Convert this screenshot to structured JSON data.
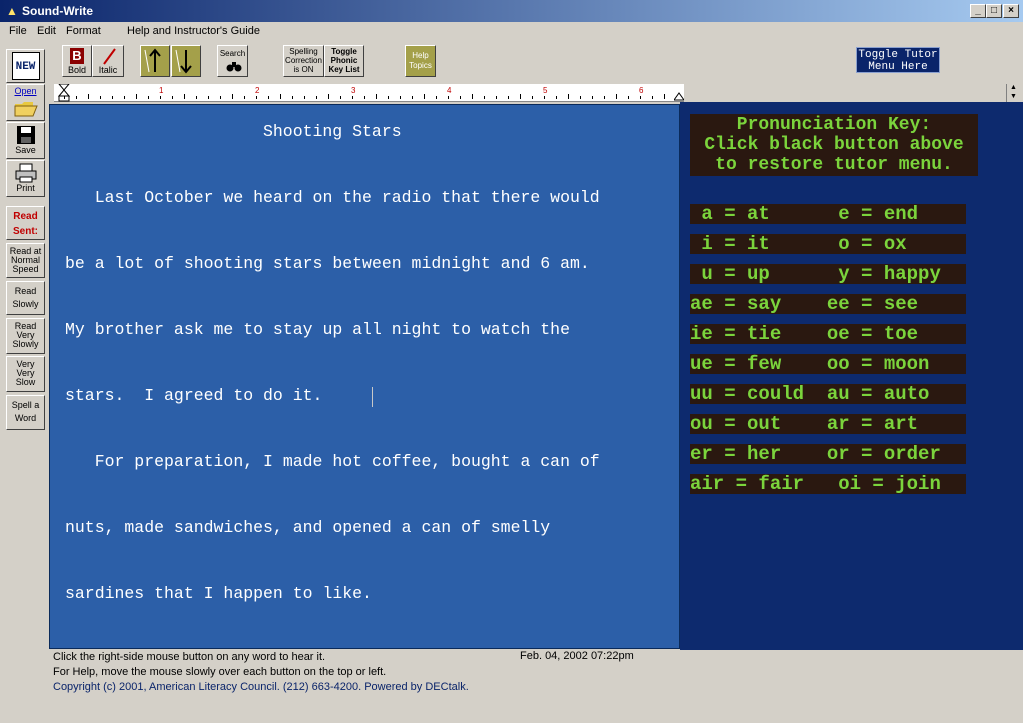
{
  "window": {
    "title": "Sound-Write"
  },
  "menu": [
    "File",
    "Edit",
    "Format",
    "Help and Instructor's Guide"
  ],
  "toolbar": {
    "bold": "Bold",
    "italic": "Italic",
    "search": "Search",
    "spelling": [
      "Spelling",
      "Correction",
      "is ON"
    ],
    "toggle_phonic": [
      "Toggle",
      "Phonic",
      "Key List"
    ],
    "help_topics": [
      "Help",
      "Topics"
    ],
    "tutor": [
      "Toggle Tutor",
      "Menu  Here"
    ]
  },
  "sidebar": {
    "new": "NEW",
    "open": "Open",
    "save": "Save",
    "print": "Print",
    "read_sent": [
      "Read",
      "Sent:"
    ],
    "normal": [
      "Read at",
      "Normal",
      "Speed"
    ],
    "slowly": [
      "Read",
      "Slowly"
    ],
    "very_slowly": [
      "Read",
      "Very",
      "Slowly"
    ],
    "very_very": [
      "Very",
      "Very",
      "Slow"
    ],
    "spell": [
      "Spell a",
      "Word"
    ]
  },
  "ruler_numbers": [
    "1",
    "2",
    "3",
    "4",
    "5",
    "6"
  ],
  "document": {
    "title": "Shooting Stars",
    "lines": [
      "   Last October we heard on the radio that there would",
      "be a lot of shooting stars between midnight and 6 am.",
      "My brother ask me to stay up all night to watch the",
      "stars.  I agreed to do it.",
      "   For preparation, I made hot coffee, bought a can of",
      "nuts, made sandwiches, and opened a can of smelly",
      "sardines that I happen to like."
    ]
  },
  "pronunciation": {
    "heading": [
      "Pronunciation Key:",
      "Click black button above",
      "to restore tutor menu."
    ],
    "rows": [
      " a = at      e = end",
      " i = it      o = ox",
      " u = up      y = happy",
      "ae = say    ee = see",
      "ie = tie    oe = toe",
      "ue = few    oo = moon",
      "uu = could  au = auto",
      "ou = out    ar = art",
      "er = her    or = order",
      "air = fair   oi = join"
    ]
  },
  "status": {
    "line1": "Click the right-side mouse button on any word to hear it.",
    "date": "Feb. 04, 2002  07:22pm",
    "line2": "For Help, move the mouse slowly over each button on the top or left.",
    "line3": "Copyright (c) 2001, American Literacy Council.  (212) 663-4200.   Powered by DECtalk."
  }
}
